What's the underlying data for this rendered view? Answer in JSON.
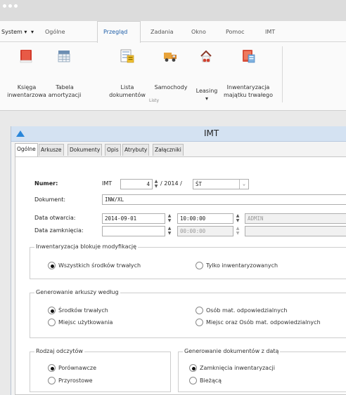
{
  "menubar": {
    "items": [
      "System ▾",
      "▾",
      "Ogólne",
      "Przegląd",
      "Zadania",
      "Okno",
      "Pomoc",
      "IMT"
    ]
  },
  "ribbon": {
    "buttons": [
      {
        "label": "Księga\ninwentarzowa",
        "icon": "book-icon"
      },
      {
        "label": "Tabela\namortyzacji",
        "icon": "table-icon"
      },
      {
        "label": "Lista\ndokumentów",
        "icon": "documents-list-icon"
      },
      {
        "label": "Samochody",
        "icon": "truck-icon"
      },
      {
        "label": "Leasing\n▾",
        "icon": "leasing-icon"
      },
      {
        "label": "Inwentaryzacja\nmajątku trwałego",
        "icon": "inventory-icon"
      }
    ],
    "group_label": "Listy"
  },
  "dialog": {
    "title": "IMT",
    "tabs": [
      "Ogólne",
      "Arkusze",
      "Dokumenty",
      "Opis",
      "Atrybuty",
      "Załączniki"
    ],
    "numer": {
      "label": "Numer:",
      "prefix": "IMT",
      "value": "4",
      "year_sep": "/ 2014 /",
      "series": "ŚT"
    },
    "dokument": {
      "label": "Dokument:",
      "value": "INW/XL"
    },
    "data_otwarcia": {
      "label": "Data otwarcia:",
      "date": "2014-09-01",
      "time": "10:00:00",
      "user": "ADMIN"
    },
    "data_zamkniecia": {
      "label": "Data zamknięcia:",
      "date": "",
      "time": "00:00:00",
      "user": ""
    },
    "group_blokuje": {
      "title": "Inwentaryzacja blokuje modyfikację",
      "options": [
        {
          "label": "Wszystkich środków trwałych",
          "checked": true
        },
        {
          "label": "Tylko inwentaryzowanych",
          "checked": false
        }
      ]
    },
    "group_arkusze": {
      "title": "Generowanie arkuszy według",
      "options": [
        {
          "label": "Środków trwałych",
          "checked": true
        },
        {
          "label": "Miejsc użytkowania",
          "checked": false
        },
        {
          "label": "Osób mat. odpowiedzialnych",
          "checked": false
        },
        {
          "label": "Miejsc oraz Osób mat. odpowiedzialnych",
          "checked": false
        }
      ]
    },
    "group_odczytow": {
      "title": "Rodzaj odczytów",
      "options": [
        {
          "label": "Porównawcze",
          "checked": true
        },
        {
          "label": "Przyrostowe",
          "checked": false
        }
      ]
    },
    "group_dokumentow": {
      "title": "Generowanie dokumentów z datą",
      "options": [
        {
          "label": "Zamknięcia inwentaryzacji",
          "checked": true
        },
        {
          "label": "Bieżącą",
          "checked": false
        }
      ]
    }
  }
}
